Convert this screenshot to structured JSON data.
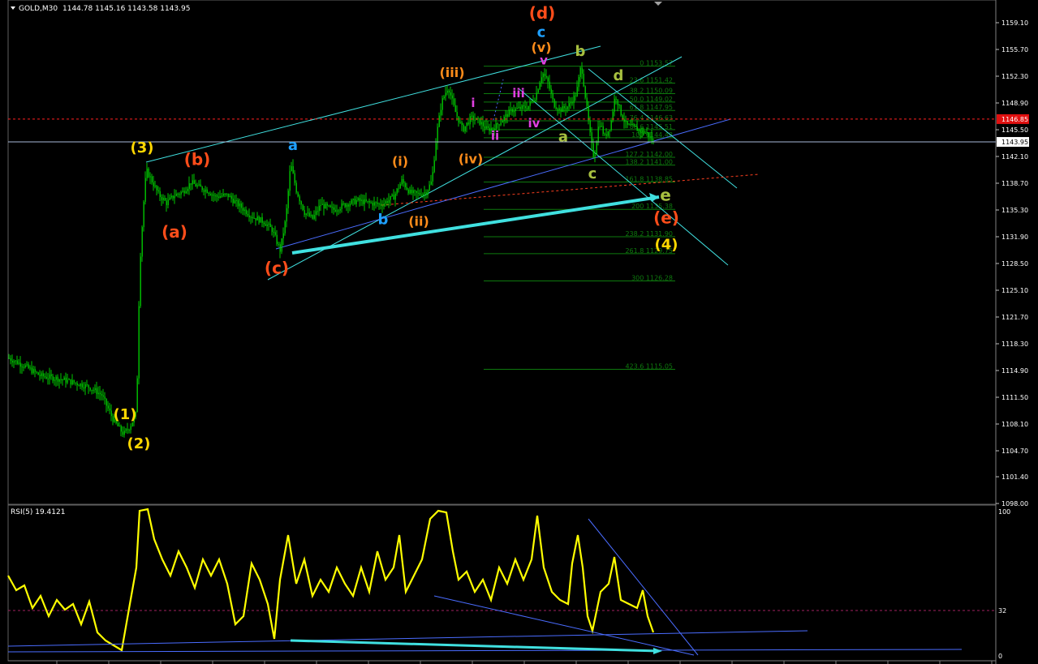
{
  "header": {
    "symbol": "GOLD,M30",
    "ohlc": "1144.78 1145.16 1143.58 1143.95"
  },
  "price_scale": {
    "ticks": [
      "1159.10",
      "1155.70",
      "1152.30",
      "1148.90",
      "1145.50",
      "1142.10",
      "1138.70",
      "1135.30",
      "1131.90",
      "1128.50",
      "1125.10",
      "1121.70",
      "1118.30",
      "1114.90",
      "1111.50",
      "1108.10",
      "1104.70",
      "1101.40",
      "1098.00"
    ],
    "current_price": "1143.95",
    "red_level": "1146.85"
  },
  "rsi": {
    "label": "RSI(5) 19.4121",
    "ticks": [
      "100",
      "32",
      "0"
    ]
  },
  "colors": {
    "bull": "#00c800",
    "bear": "#00c800",
    "wave_orange": "#ff8c1a",
    "wave_red": "#ff4d1a",
    "wave_yellow": "#ffd700",
    "wave_blue": "#1ea0ff",
    "wave_magenta": "#e040e0",
    "wave_olive": "#a8c040",
    "trend_cyan": "#40e0e0",
    "trend_blue": "#4a6cff",
    "rsi_line": "#ffff00",
    "fib": "#0e7a0e"
  },
  "fib_levels": [
    {
      "label": "0 1153.57",
      "price": 1153.57
    },
    {
      "label": "23.6 1151.42",
      "price": 1151.42
    },
    {
      "label": "38.2 1150.09",
      "price": 1150.09
    },
    {
      "label": "50.0 1149.02",
      "price": 1149.02
    },
    {
      "label": "61.8 1147.95",
      "price": 1147.95
    },
    {
      "label": "76.4 1146.63",
      "price": 1146.63
    },
    {
      "label": "88.6 1145.51",
      "price": 1145.51
    },
    {
      "label": "100 1144.48",
      "price": 1144.48
    },
    {
      "label": "127.2 1142.00",
      "price": 1142.0
    },
    {
      "label": "138.2 1141.00",
      "price": 1141.0
    },
    {
      "label": "161.8 1138.85",
      "price": 1138.85
    },
    {
      "label": "200 1135.38",
      "price": 1135.38
    },
    {
      "label": "238.2 1131.90",
      "price": 1131.9
    },
    {
      "label": "261.8 1129.75",
      "price": 1129.75
    },
    {
      "label": "300 1126.28",
      "price": 1126.28
    },
    {
      "label": "423.6 1115.05",
      "price": 1115.05
    }
  ],
  "wave_labels": [
    {
      "text": "(d)",
      "color": "wave_red",
      "x": 668,
      "price": 1159.6,
      "size": 20
    },
    {
      "text": "c",
      "color": "wave_blue",
      "x": 667,
      "price": 1157.3,
      "size": 18
    },
    {
      "text": "(v)",
      "color": "wave_orange",
      "x": 667,
      "price": 1155.4,
      "size": 16
    },
    {
      "text": "v",
      "color": "wave_magenta",
      "x": 670,
      "price": 1153.8,
      "size": 15
    },
    {
      "text": "b",
      "color": "wave_olive",
      "x": 715,
      "price": 1154.9,
      "size": 18
    },
    {
      "text": "d",
      "color": "wave_olive",
      "x": 762,
      "price": 1151.8,
      "size": 18
    },
    {
      "text": "(iii)",
      "color": "wave_orange",
      "x": 557,
      "price": 1152.2,
      "size": 16
    },
    {
      "text": "i",
      "color": "wave_magenta",
      "x": 583,
      "price": 1148.4,
      "size": 15
    },
    {
      "text": "iii",
      "color": "wave_magenta",
      "x": 639,
      "price": 1149.6,
      "size": 15
    },
    {
      "text": "ii",
      "color": "wave_magenta",
      "x": 610,
      "price": 1144.2,
      "size": 15
    },
    {
      "text": "iv",
      "color": "wave_magenta",
      "x": 658,
      "price": 1145.8,
      "size": 15
    },
    {
      "text": "a",
      "color": "wave_olive",
      "x": 694,
      "price": 1144.0,
      "size": 18
    },
    {
      "text": "(iv)",
      "color": "wave_orange",
      "x": 580,
      "price": 1141.2,
      "size": 16
    },
    {
      "text": "c",
      "color": "wave_olive",
      "x": 730,
      "price": 1139.3,
      "size": 18
    },
    {
      "text": "e",
      "color": "wave_olive",
      "x": 820,
      "price": 1136.5,
      "size": 20
    },
    {
      "text": "(e)",
      "color": "wave_red",
      "x": 821,
      "price": 1133.6,
      "size": 20
    },
    {
      "text": "(4)",
      "color": "wave_yellow",
      "x": 821,
      "price": 1130.3,
      "size": 18
    },
    {
      "text": "(3)",
      "color": "wave_yellow",
      "x": 175,
      "price": 1142.6,
      "size": 18
    },
    {
      "text": "(b)",
      "color": "wave_red",
      "x": 243,
      "price": 1141.0,
      "size": 20
    },
    {
      "text": "a",
      "color": "wave_blue",
      "x": 361,
      "price": 1142.9,
      "size": 18
    },
    {
      "text": "(i)",
      "color": "wave_orange",
      "x": 493,
      "price": 1140.9,
      "size": 16
    },
    {
      "text": "b",
      "color": "wave_blue",
      "x": 472,
      "price": 1133.5,
      "size": 18
    },
    {
      "text": "(ii)",
      "color": "wave_orange",
      "x": 516,
      "price": 1133.3,
      "size": 16
    },
    {
      "text": "(a)",
      "color": "wave_red",
      "x": 215,
      "price": 1131.8,
      "size": 20
    },
    {
      "text": "(c)",
      "color": "wave_red",
      "x": 341,
      "price": 1127.2,
      "size": 20
    },
    {
      "text": "(1)",
      "color": "wave_yellow",
      "x": 154,
      "price": 1108.7,
      "size": 18
    },
    {
      "text": "(2)",
      "color": "wave_yellow",
      "x": 171,
      "price": 1105.0,
      "size": 18
    }
  ],
  "chart_data": {
    "type": "candlestick",
    "title": "GOLD,M30",
    "ylim": [
      1096.6,
      1161.2
    ],
    "price_path": [
      [
        10,
        1116.5
      ],
      [
        30,
        1115.5
      ],
      [
        50,
        1114.2
      ],
      [
        70,
        1113.9
      ],
      [
        90,
        1113.4
      ],
      [
        110,
        1112.8
      ],
      [
        125,
        1111.8
      ],
      [
        140,
        1108.5
      ],
      [
        152,
        1106.8
      ],
      [
        160,
        1107.8
      ],
      [
        168,
        1109.5
      ],
      [
        172,
        1128.0
      ],
      [
        176,
        1135.0
      ],
      [
        180,
        1140.4
      ],
      [
        186,
        1139.2
      ],
      [
        195,
        1137.3
      ],
      [
        205,
        1136.2
      ],
      [
        215,
        1137.2
      ],
      [
        225,
        1137.6
      ],
      [
        235,
        1138.8
      ],
      [
        245,
        1138.2
      ],
      [
        255,
        1137.8
      ],
      [
        265,
        1137.0
      ],
      [
        280,
        1137.2
      ],
      [
        295,
        1135.8
      ],
      [
        310,
        1134.5
      ],
      [
        325,
        1133.8
      ],
      [
        335,
        1132.8
      ],
      [
        345,
        1130.2
      ],
      [
        352,
        1134.2
      ],
      [
        358,
        1141.2
      ],
      [
        365,
        1137.8
      ],
      [
        375,
        1135.0
      ],
      [
        385,
        1134.2
      ],
      [
        395,
        1136.0
      ],
      [
        410,
        1135.3
      ],
      [
        425,
        1136.0
      ],
      [
        440,
        1136.5
      ],
      [
        455,
        1136.2
      ],
      [
        470,
        1136.0
      ],
      [
        485,
        1137.0
      ],
      [
        495,
        1139.0
      ],
      [
        505,
        1137.5
      ],
      [
        515,
        1137.3
      ],
      [
        525,
        1137.6
      ],
      [
        532,
        1139.0
      ],
      [
        538,
        1145.0
      ],
      [
        544,
        1149.0
      ],
      [
        552,
        1151.0
      ],
      [
        560,
        1148.0
      ],
      [
        570,
        1145.5
      ],
      [
        580,
        1147.0
      ],
      [
        590,
        1146.6
      ],
      [
        600,
        1145.5
      ],
      [
        610,
        1145.9
      ],
      [
        620,
        1146.9
      ],
      [
        630,
        1148.0
      ],
      [
        640,
        1148.2
      ],
      [
        650,
        1148.4
      ],
      [
        660,
        1149.8
      ],
      [
        668,
        1152.8
      ],
      [
        675,
        1151.5
      ],
      [
        682,
        1148.8
      ],
      [
        690,
        1148.0
      ],
      [
        700,
        1148.5
      ],
      [
        710,
        1150.1
      ],
      [
        716,
        1153.8
      ],
      [
        722,
        1149.0
      ],
      [
        728,
        1144.0
      ],
      [
        732,
        1141.8
      ],
      [
        738,
        1146.6
      ],
      [
        745,
        1144.6
      ],
      [
        752,
        1146.0
      ],
      [
        758,
        1150.0
      ],
      [
        765,
        1147.6
      ],
      [
        772,
        1146.0
      ],
      [
        780,
        1145.8
      ],
      [
        790,
        1145.3
      ],
      [
        798,
        1145.0
      ],
      [
        805,
        1143.8
      ]
    ],
    "rsi_path": [
      [
        10,
        710
      ],
      [
        20,
        728
      ],
      [
        30,
        722
      ],
      [
        40,
        750
      ],
      [
        50,
        735
      ],
      [
        60,
        760
      ],
      [
        70,
        740
      ],
      [
        80,
        752
      ],
      [
        90,
        745
      ],
      [
        100,
        770
      ],
      [
        110,
        742
      ],
      [
        120,
        780
      ],
      [
        130,
        790
      ],
      [
        140,
        796
      ],
      [
        150,
        802
      ],
      [
        160,
        745
      ],
      [
        168,
        700
      ],
      [
        172,
        630
      ],
      [
        182,
        628
      ],
      [
        190,
        665
      ],
      [
        200,
        690
      ],
      [
        210,
        710
      ],
      [
        220,
        680
      ],
      [
        230,
        700
      ],
      [
        240,
        725
      ],
      [
        250,
        690
      ],
      [
        260,
        710
      ],
      [
        270,
        690
      ],
      [
        280,
        720
      ],
      [
        290,
        770
      ],
      [
        300,
        760
      ],
      [
        310,
        695
      ],
      [
        320,
        715
      ],
      [
        330,
        745
      ],
      [
        338,
        788
      ],
      [
        345,
        715
      ],
      [
        355,
        660
      ],
      [
        365,
        720
      ],
      [
        375,
        690
      ],
      [
        385,
        735
      ],
      [
        395,
        715
      ],
      [
        405,
        730
      ],
      [
        415,
        700
      ],
      [
        425,
        720
      ],
      [
        435,
        735
      ],
      [
        445,
        700
      ],
      [
        455,
        730
      ],
      [
        465,
        680
      ],
      [
        475,
        715
      ],
      [
        485,
        700
      ],
      [
        492,
        660
      ],
      [
        500,
        730
      ],
      [
        510,
        710
      ],
      [
        520,
        690
      ],
      [
        530,
        640
      ],
      [
        540,
        630
      ],
      [
        550,
        632
      ],
      [
        558,
        680
      ],
      [
        565,
        715
      ],
      [
        575,
        705
      ],
      [
        585,
        730
      ],
      [
        595,
        715
      ],
      [
        605,
        740
      ],
      [
        615,
        700
      ],
      [
        625,
        720
      ],
      [
        635,
        690
      ],
      [
        645,
        715
      ],
      [
        655,
        690
      ],
      [
        662,
        636
      ],
      [
        670,
        700
      ],
      [
        680,
        730
      ],
      [
        690,
        740
      ],
      [
        700,
        745
      ],
      [
        705,
        695
      ],
      [
        712,
        660
      ],
      [
        718,
        700
      ],
      [
        724,
        760
      ],
      [
        730,
        778
      ],
      [
        740,
        730
      ],
      [
        750,
        720
      ],
      [
        757,
        687
      ],
      [
        765,
        740
      ],
      [
        775,
        745
      ],
      [
        785,
        750
      ],
      [
        792,
        728
      ],
      [
        798,
        760
      ],
      [
        805,
        780
      ]
    ],
    "rsi_ylim": [
      0,
      100
    ]
  }
}
